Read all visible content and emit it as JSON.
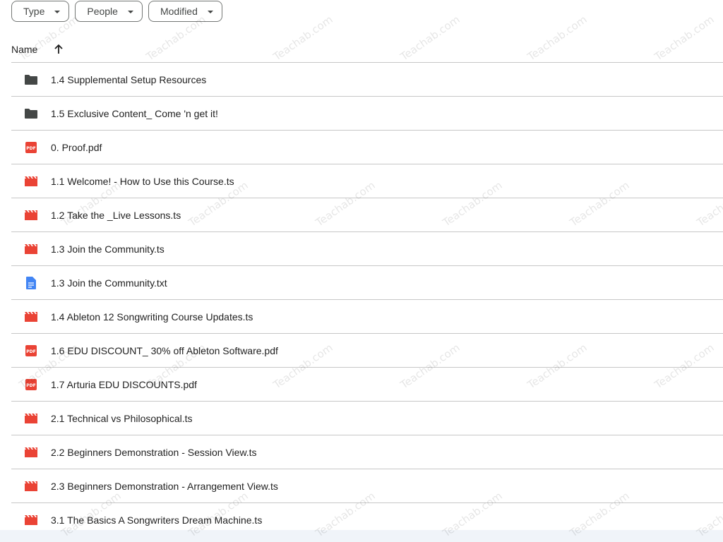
{
  "filters": {
    "type": "Type",
    "people": "People",
    "modified": "Modified"
  },
  "header": {
    "name": "Name"
  },
  "files": [
    {
      "name": "1.4 Supplemental Setup Resources",
      "kind": "folder"
    },
    {
      "name": "1.5 Exclusive Content_ Come 'n get it!",
      "kind": "folder"
    },
    {
      "name": "0. Proof.pdf",
      "kind": "pdf"
    },
    {
      "name": "1.1 Welcome! - How to Use this Course.ts",
      "kind": "video"
    },
    {
      "name": "1.2 Take the _Live Lessons.ts",
      "kind": "video"
    },
    {
      "name": "1.3 Join the Community.ts",
      "kind": "video"
    },
    {
      "name": "1.3 Join the Community.txt",
      "kind": "doc"
    },
    {
      "name": "1.4 Ableton 12 Songwriting Course Updates.ts",
      "kind": "video"
    },
    {
      "name": "1.6 EDU DISCOUNT_ 30% off Ableton Software.pdf",
      "kind": "pdf"
    },
    {
      "name": "1.7 Arturia EDU DISCOUNTS.pdf",
      "kind": "pdf"
    },
    {
      "name": "2.1 Technical vs Philosophical.ts",
      "kind": "video"
    },
    {
      "name": "2.2 Beginners Demonstration - Session View.ts",
      "kind": "video"
    },
    {
      "name": "2.3 Beginners Demonstration - Arrangement View.ts",
      "kind": "video"
    },
    {
      "name": "3.1 The Basics A Songwriters Dream Machine.ts",
      "kind": "video"
    }
  ],
  "watermark": "Teachab.com",
  "colors": {
    "folder": "#444746",
    "pdf": "#ea4335",
    "video": "#ea4335",
    "doc": "#4285f4"
  }
}
